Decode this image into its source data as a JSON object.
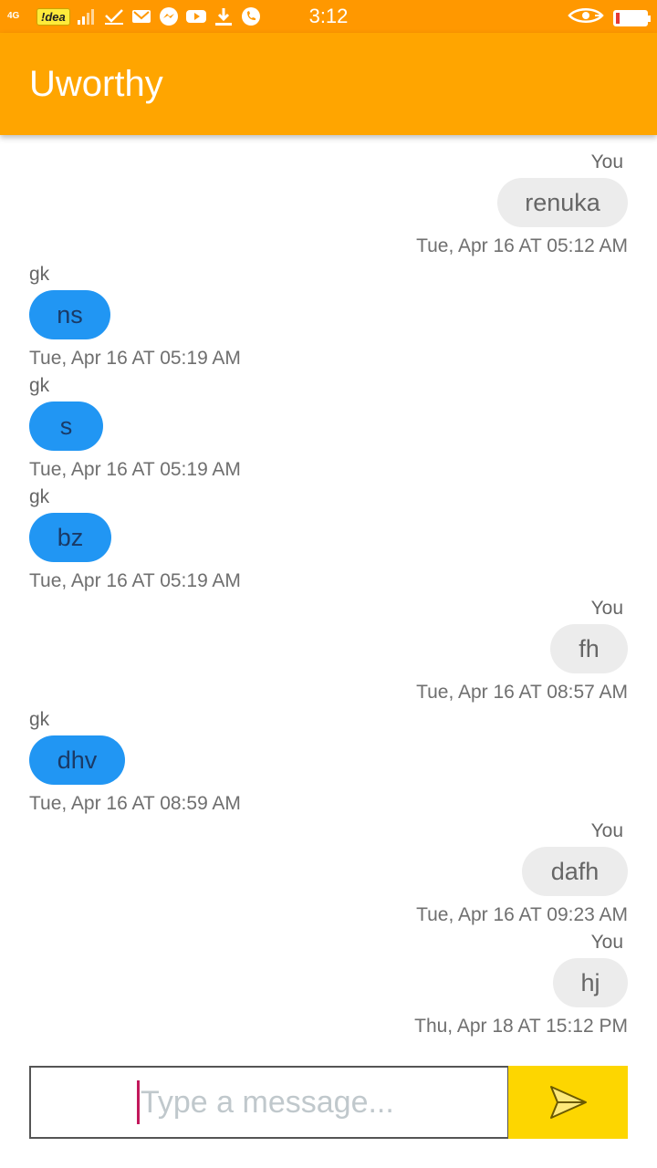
{
  "status_bar": {
    "network": "4G",
    "carrier": "!dea",
    "time": "3:12",
    "icons": [
      "signal-icon",
      "carrier-badge",
      "signal-icon",
      "check-icon",
      "gmail-icon",
      "messenger-icon",
      "youtube-icon",
      "download-icon",
      "phone-icon",
      "eye-icon",
      "battery-icon"
    ],
    "battery_level": 0.12,
    "battery_color": "#e53935"
  },
  "app_bar": {
    "title": "Uworthy",
    "color": "#ffa500"
  },
  "messages": [
    {
      "sender": "You",
      "text": "renuka",
      "time": "Tue, Apr 16 AT 05:12 AM",
      "side": "right"
    },
    {
      "sender": "gk",
      "text": "ns",
      "time": "Tue, Apr 16 AT 05:19 AM",
      "side": "left"
    },
    {
      "sender": "gk",
      "text": "s",
      "time": "Tue, Apr 16 AT 05:19 AM",
      "side": "left"
    },
    {
      "sender": "gk",
      "text": "bz",
      "time": "Tue, Apr 16 AT 05:19 AM",
      "side": "left"
    },
    {
      "sender": "You",
      "text": "fh",
      "time": "Tue, Apr 16 AT 08:57 AM",
      "side": "right"
    },
    {
      "sender": "gk",
      "text": "dhv",
      "time": "Tue, Apr 16 AT 08:59 AM",
      "side": "left"
    },
    {
      "sender": "You",
      "text": "dafh",
      "time": "Tue, Apr 16 AT 09:23 AM",
      "side": "right"
    },
    {
      "sender": "You",
      "text": "hj",
      "time": "Thu, Apr 18 AT 15:12 PM",
      "side": "right"
    }
  ],
  "colors": {
    "gk_bubble": "#2196f3",
    "you_bubble": "#ececec",
    "send_button": "#fdd600"
  },
  "composer": {
    "placeholder": "Type a message...",
    "value": "",
    "send_icon": "send-icon"
  }
}
